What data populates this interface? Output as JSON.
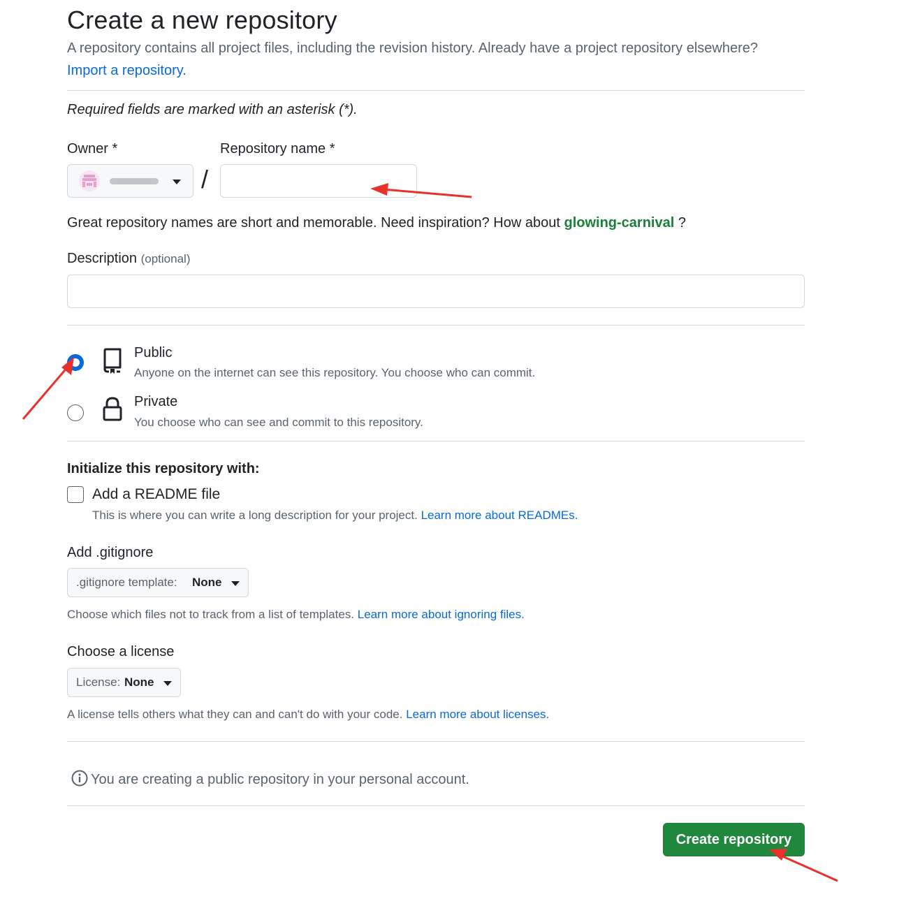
{
  "header": {
    "title": "Create a new repository",
    "intro": "A repository contains all project files, including the revision history. Already have a project repository elsewhere?",
    "import_link": "Import a repository."
  },
  "required_note": "Required fields are marked with an asterisk (*).",
  "owner": {
    "label": "Owner *",
    "icon": "avatar"
  },
  "separator": "/",
  "repo_name": {
    "label": "Repository name *",
    "value": "",
    "placeholder": ""
  },
  "suggestion": {
    "prefix": "Great repository names are short and memorable. Need inspiration? How about",
    "name": "glowing-carnival",
    "suffix": "?"
  },
  "description": {
    "label": "Description",
    "optional": "(optional)",
    "value": ""
  },
  "visibility": {
    "selected": "public",
    "options": [
      {
        "id": "public",
        "title": "Public",
        "desc": "Anyone on the internet can see this repository. You choose who can commit.",
        "icon": "repo-icon"
      },
      {
        "id": "private",
        "title": "Private",
        "desc": "You choose who can see and commit to this repository.",
        "icon": "lock-icon"
      }
    ]
  },
  "initialize": {
    "heading": "Initialize this repository with:",
    "readme_label": "Add a README file",
    "readme_checked": false,
    "readme_help": "This is where you can write a long description for your project.",
    "readme_link": "Learn more about READMEs."
  },
  "gitignore": {
    "heading": "Add .gitignore",
    "select_key": ".gitignore template:",
    "select_value": "None",
    "help": "Choose which files not to track from a list of templates.",
    "link": "Learn more about ignoring files."
  },
  "license": {
    "heading": "Choose a license",
    "select_key": "License:",
    "select_value": "None",
    "help": "A license tells others what they can and can't do with your code.",
    "link": "Learn more about licenses."
  },
  "notice": {
    "text": "You are creating a public repository in your personal account.",
    "icon": "info-icon"
  },
  "submit_label": "Create repository",
  "colors": {
    "primary_button": "#1f883d",
    "link": "#0969da",
    "suggestion": "#1a7f37",
    "annotation_arrow": "#e8312a"
  }
}
